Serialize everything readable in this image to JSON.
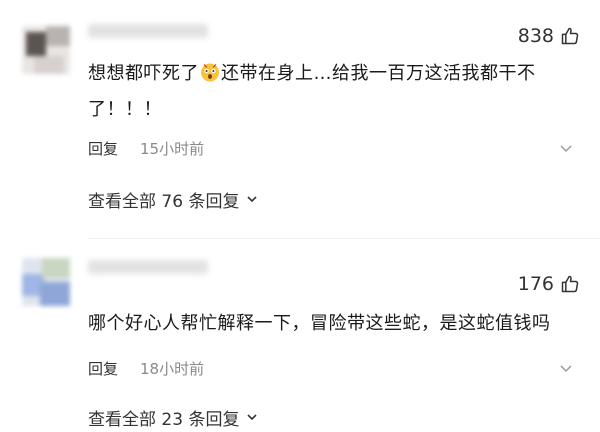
{
  "comments": [
    {
      "avatar_icon": "user-avatar-blurred",
      "likes": "838",
      "content_before_emoji": "想想都吓死了",
      "emoji_icon": "scared-face-emoji",
      "content_after_emoji": "还带在身上…给我一百万这活我都干不了！！！",
      "reply_label": "回复",
      "time": "15小时前",
      "view_replies": "查看全部 76 条回复"
    },
    {
      "avatar_icon": "user-avatar-blurred",
      "likes": "176",
      "content": "哪个好心人帮忙解释一下，冒险带这些蛇，是这蛇值钱吗",
      "reply_label": "回复",
      "time": "18小时前",
      "view_replies": "查看全部 23 条回复"
    }
  ],
  "colors": {
    "text_primary": "#1a1a1a",
    "text_secondary": "#333333",
    "text_muted": "#8a8a8a",
    "divider": "#eeeeee"
  }
}
